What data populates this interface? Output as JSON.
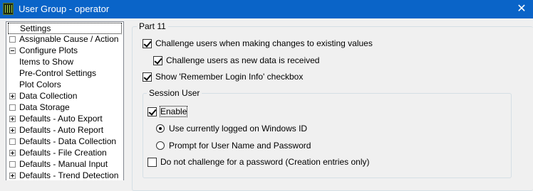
{
  "window": {
    "title": "User Group - operator",
    "close_glyph": "✕"
  },
  "tree": {
    "root": "Settings",
    "items": [
      {
        "label": "Assignable Cause / Action",
        "expander": "none"
      },
      {
        "label": "Configure Plots",
        "expander": "minus"
      },
      {
        "label": "Items to Show",
        "expander": "child"
      },
      {
        "label": "Pre-Control Settings",
        "expander": "child"
      },
      {
        "label": "Plot Colors",
        "expander": "child"
      },
      {
        "label": "Data Collection",
        "expander": "plus"
      },
      {
        "label": "Data Storage",
        "expander": "none"
      },
      {
        "label": "Defaults - Auto Export",
        "expander": "plus"
      },
      {
        "label": "Defaults - Auto Report",
        "expander": "plus"
      },
      {
        "label": "Defaults - Data Collection",
        "expander": "none"
      },
      {
        "label": "Defaults - File Creation",
        "expander": "plus"
      },
      {
        "label": "Defaults - Manual Input",
        "expander": "none"
      },
      {
        "label": "Defaults - Trend Detection",
        "expander": "plus"
      }
    ]
  },
  "part11": {
    "legend": "Part 11",
    "challenge_changes": {
      "label": "Challenge users when making changes to existing values",
      "checked": true
    },
    "challenge_new_data": {
      "label": "Challenge users as new data is received",
      "checked": true
    },
    "remember_login": {
      "label": "Show 'Remember Login Info' checkbox",
      "checked": true
    }
  },
  "session_user": {
    "legend": "Session User",
    "enable": {
      "label": "Enable",
      "checked": true
    },
    "use_windows_id": {
      "label": "Use currently logged on Windows ID",
      "selected": true
    },
    "prompt_credentials": {
      "label": "Prompt for User Name and Password",
      "selected": false
    },
    "no_challenge_creation": {
      "label": "Do not challenge for a password (Creation entries only)",
      "checked": false
    }
  },
  "colors": {
    "titlebar": "#0a64c8",
    "window_bg": "#f0f0f0",
    "tree_bg": "#ffffff"
  }
}
